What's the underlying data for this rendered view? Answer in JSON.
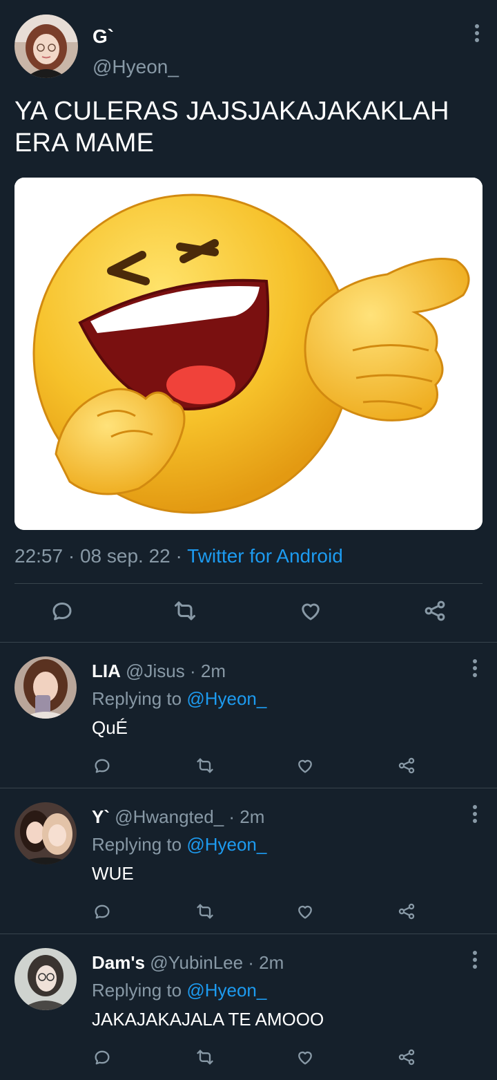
{
  "tweet": {
    "display_name": "G`",
    "handle": "@Hyeon_",
    "text_line1": "YA CULERAS JAJSJAKAJAKAKLAH",
    "text_line2": "ERA MAME",
    "time": "22:57",
    "sep1": " · ",
    "date": "08 sep. 22",
    "sep2": " · ",
    "source": "Twitter for Android",
    "icons": [
      "reply-icon",
      "retweet-icon",
      "like-icon",
      "share-icon"
    ]
  },
  "replies": [
    {
      "name": "LIA",
      "handle": "@Jisus",
      "age": " · 2m",
      "replying_prefix": "Replying to ",
      "replying_to": "@Hyeon_",
      "text": "QuÉ"
    },
    {
      "name": "Y`",
      "handle": "@Hwangted_",
      "age": " · 2m",
      "replying_prefix": "Replying to ",
      "replying_to": "@Hyeon_",
      "text": "WUE"
    },
    {
      "name": "Dam's",
      "handle": "@YubinLee",
      "age": " · 2m",
      "replying_prefix": "Replying to ",
      "replying_to": "@Hyeon_",
      "text": "JAKAJAKAJALA TE AMOOO"
    }
  ],
  "colors": {
    "background": "#15202b",
    "muted": "#8899a6",
    "link": "#1d9bf0",
    "divider": "#38444d",
    "emoji_yellow": "#f6c12a"
  }
}
